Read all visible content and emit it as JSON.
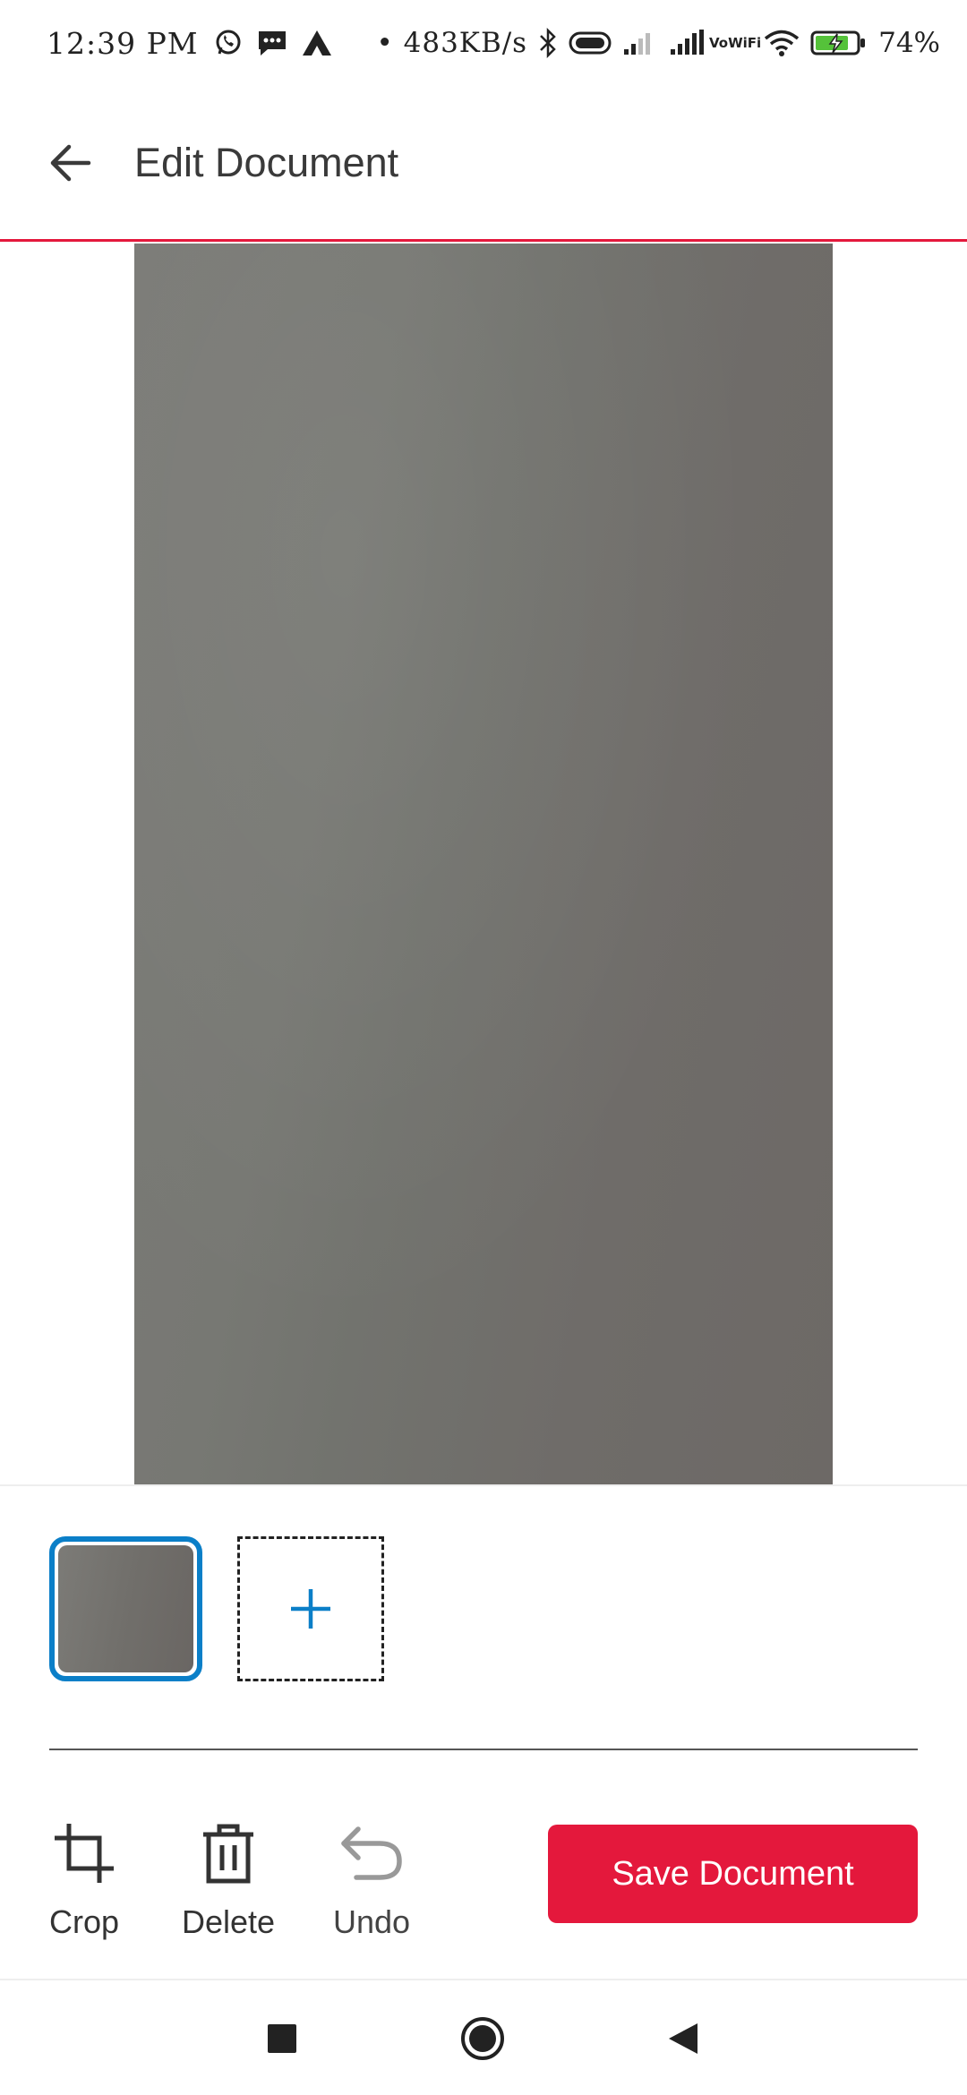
{
  "status_bar": {
    "time": "12:39 PM",
    "net_speed": "483KB/s",
    "battery_percent": "74%",
    "vowifi_line1": "Vo",
    "vowifi_line2": "WiFi",
    "icons": [
      "whatsapp-icon",
      "message-icon",
      "app-notification-icon",
      "bluetooth-icon",
      "toggle-icon",
      "signal-weak-icon",
      "signal-full-icon",
      "vowifi-icon",
      "wifi-icon",
      "battery-charging-icon"
    ]
  },
  "app_bar": {
    "title": "Edit Document",
    "back_icon": "arrow-left-icon",
    "accent_color": "#e4183c"
  },
  "pages": {
    "selected_index": 0,
    "add_icon": "plus-icon",
    "selected_border_color": "#0b7fc8"
  },
  "toolbar": {
    "crop_label": "Crop",
    "delete_label": "Delete",
    "undo_label": "Undo",
    "save_label": "Save Document"
  },
  "nav_bar": {
    "icons": [
      "recents-square-icon",
      "home-circle-icon",
      "back-triangle-icon"
    ]
  }
}
